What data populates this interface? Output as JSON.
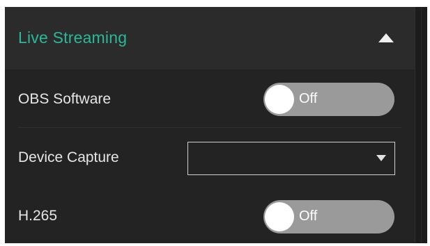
{
  "section": {
    "title": "Live Streaming",
    "collapse_icon": "triangle-up-icon",
    "accent_color": "#2bb89a"
  },
  "settings": {
    "obs": {
      "label": "OBS Software",
      "state": "Off"
    },
    "device_capture": {
      "label": "Device Capture",
      "value": "",
      "dropdown_icon": "triangle-down-icon"
    },
    "h265": {
      "label": "H.265",
      "state": "Off"
    }
  }
}
